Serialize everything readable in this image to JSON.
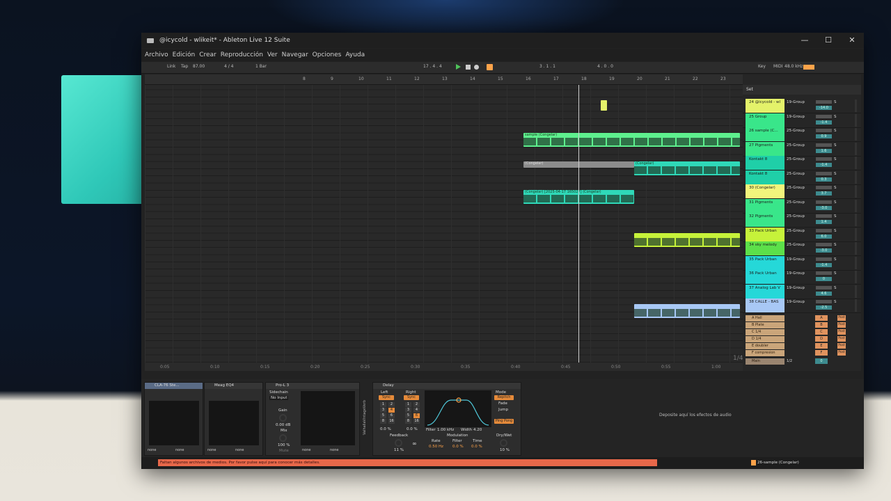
{
  "window": {
    "title": "@icycold - wlikeit* - Ableton Live 12 Suite",
    "controls": [
      "—",
      "☐",
      "✕"
    ]
  },
  "menu": [
    "Archivo",
    "Edición",
    "Crear",
    "Reproducción",
    "Ver",
    "Navegar",
    "Opciones",
    "Ayuda"
  ],
  "control_bar": {
    "link": "Link",
    "tap": "Tap",
    "tempo": "87.00",
    "meter": "4 / 4",
    "quantize": "1 Bar",
    "position": "17 .   4 .   4",
    "loop_start": "3 .   1 .   1",
    "loop_length": "4 .   0 .   0",
    "key": "Key",
    "midi": "MIDI",
    "sample_rate": "48.0 kHz"
  },
  "ruler": [
    "8",
    "9",
    "10",
    "11",
    "12",
    "13",
    "14",
    "15",
    "16",
    "17",
    "18",
    "19",
    "20",
    "21",
    "22",
    "23"
  ],
  "timebar": [
    "0:05",
    "0:10",
    "0:15",
    "0:20",
    "0:25",
    "0:30",
    "0:35",
    "0:40",
    "0:45",
    "0:50",
    "0:55",
    "1:00"
  ],
  "zoom_label": "1/4",
  "set_label": "Set",
  "clips": [
    {
      "name": "sample (Congelar)"
    },
    {
      "name": "(Congelar)"
    },
    {
      "name": "(Congelar)"
    },
    {
      "name": "(Congelar) [2025-04-17 165027] (Congelar)"
    }
  ],
  "tracks": [
    {
      "name": "24 @icycold - wl",
      "io": "19-Group",
      "vol": "-14.0",
      "color": "#e4f26a"
    },
    {
      "name": "25 Group",
      "io": "19-Group",
      "vol": "-1.4",
      "color": "#39e68a"
    },
    {
      "name": "26 sample (C...",
      "io": "25-Group",
      "vol": "0.9",
      "color": "#39e68a"
    },
    {
      "name": "27 Pigments",
      "io": "25-Group",
      "vol": "1.6",
      "color": "#39e68a"
    },
    {
      "name": "Kontakt 8",
      "io": "25-Group",
      "vol": "-1.4",
      "color": "#1fcfa8"
    },
    {
      "name": "Kontakt 8",
      "io": "25-Group",
      "vol": "0.3",
      "color": "#1fcfa8"
    },
    {
      "name": "30 (Congelar)",
      "io": "25-Group",
      "vol": "3.7",
      "color": "#f2f57c"
    },
    {
      "name": "31 Pigments",
      "io": "25-Group",
      "vol": "-3.0",
      "color": "#39e68a"
    },
    {
      "name": "32 Pigments",
      "io": "25-Group",
      "vol": "1.4",
      "color": "#39e68a"
    },
    {
      "name": "33 Pack Urban",
      "io": "25-Group",
      "vol": "6.0",
      "color": "#c6f23a"
    },
    {
      "name": "34 sky melody",
      "io": "25-Group",
      "vol": "-3.0",
      "color": "#5ce04a"
    },
    {
      "name": "35 Pack Urban",
      "io": "19-Group",
      "vol": "-1.4",
      "color": "#25d8d8"
    },
    {
      "name": "36 Pack Urban",
      "io": "19-Group",
      "vol": "0",
      "color": "#25d8d8"
    },
    {
      "name": "37 Analog Lab V",
      "io": "19-Group",
      "vol": "4.6",
      "color": "#25d8d8"
    },
    {
      "name": "38 CALLE - BAS",
      "io": "19-Group",
      "vol": "-2.5",
      "color": "#a8c8f5"
    }
  ],
  "returns": [
    {
      "name": "A Hall",
      "send": "A",
      "post": "Post"
    },
    {
      "name": "B Plate",
      "send": "B",
      "post": "Post"
    },
    {
      "name": "C 1/4",
      "send": "C",
      "post": "Post"
    },
    {
      "name": "D 1/4",
      "send": "D",
      "post": "Post"
    },
    {
      "name": "E doubler",
      "send": "E",
      "post": "Post"
    },
    {
      "name": "F compresion",
      "send": "F",
      "post": "Post"
    }
  ],
  "main_track": {
    "name": "Main",
    "io": "1/2",
    "value": "0"
  },
  "devices": {
    "cla76": {
      "name": "CLA-76 Ste...",
      "none_a": "none",
      "none_b": "none"
    },
    "meagseq4": {
      "name": "Meag EQ4",
      "none_a": "none",
      "none_b": "none"
    },
    "prol3": {
      "name": "Pro-L 3",
      "sidechain": "Sidechain",
      "no_input": "No Input",
      "gain": "Gain",
      "gain_val": "0.00 dB",
      "mix": "Mix",
      "mix_val": "100 %",
      "mute": "Mute",
      "none_a": "none",
      "none_b": "none"
    },
    "delay": {
      "name": "Delay",
      "left": "Left",
      "right": "Right",
      "sync": "Sync",
      "left_pct": "0.0 %",
      "right_pct": "0.0 %",
      "feedback": "Feedback",
      "feedback_val": "11 %",
      "filter": "Filter",
      "filter_freq": "1.00 kHz",
      "width": "Width",
      "width_val": "4.20",
      "modulation": "Modulation",
      "rate": "Rate",
      "rate_val": "0.50 Hz",
      "filter_mod": "Filter",
      "filter_mod_val": "0.0 %",
      "time": "Time",
      "time_val": "0.0 %",
      "mode": "Mode",
      "repitch": "Repitch",
      "fade": "Fade",
      "jump": "Jump",
      "ping_pong": "Ping Pong",
      "drywet": "Dry/Wet",
      "drywet_val": "10 %",
      "left_grid": [
        "1",
        "2",
        "3",
        "4",
        "5",
        "6",
        "8",
        "16"
      ],
      "right_grid": [
        "1",
        "2",
        "3",
        "4",
        "5",
        "6",
        "8",
        "16"
      ]
    },
    "drop_hint": "Deposite aquí los efectos de audio",
    "vertical_label": "ValhallaVintageVerb"
  },
  "status": {
    "warning": "Faltan algunos archivos de medios. Por favor pulse aquí para conocer más detalles.",
    "selected_track": "26-sample (Congelar)"
  },
  "colors": {
    "accent": "#ffa34a",
    "warning": "#e8684a",
    "play": "#4ec35a"
  }
}
